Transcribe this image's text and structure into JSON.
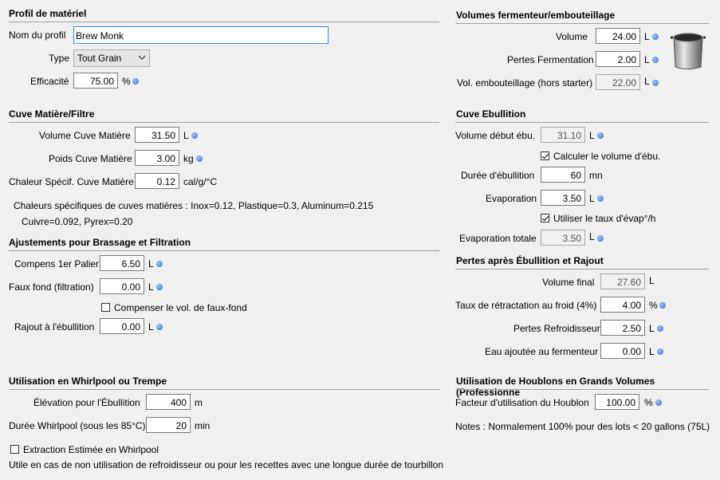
{
  "profil": {
    "title": "Profil de matériel",
    "nom_label": "Nom du profil",
    "nom_value": "Brew Monk",
    "type_label": "Type",
    "type_value": "Tout Grain",
    "efficacite_label": "Efficacité",
    "efficacite_value": "75.00",
    "efficacite_unit": "%"
  },
  "cuve_matiere": {
    "title": "Cuve Matière/Filtre",
    "volume_label": "Volume Cuve Matière",
    "volume_value": "31.50",
    "volume_unit": "L",
    "poids_label": "Poids Cuve Matière",
    "poids_value": "3.00",
    "poids_unit": "kg",
    "chaleur_label": "Chaleur Spécif. Cuve Matière",
    "chaleur_value": "0.12",
    "chaleur_unit": "cal/g/°C",
    "note_line1": "Chaleurs spécifiques de cuves matières : Inox=0.12, Plastique=0.3, Aluminum=0.215",
    "note_line2": "Cuivre=0.092, Pyrex=0.20"
  },
  "ajustements": {
    "title": "Ajustements pour Brassage et Filtration",
    "compens_label": "Compens 1er Palier",
    "compens_value": "6.50",
    "compens_unit": "L",
    "faux_fond_label": "Faux fond (filtration)",
    "faux_fond_value": "0.00",
    "faux_fond_unit": "L",
    "compenser_label": "Compenser le vol. de faux-fond",
    "rajout_label": "Rajout à l'ébullition",
    "rajout_value": "0.00",
    "rajout_unit": "L"
  },
  "whirlpool": {
    "title": "Utilisation en Whirlpool ou Trempe",
    "elevation_label": "Élévation pour l'Ébullition",
    "elevation_value": "400",
    "elevation_unit": "m",
    "duree_label": "Durée Whirlpool (sous les 85°C)",
    "duree_value": "20",
    "duree_unit": "min",
    "extraction_label": "Extraction Estimée en Whirlpool",
    "note": "Utile en cas de non utilisation de refroidisseur ou pour les recettes avec une longue durée de tourbillon"
  },
  "volumes": {
    "title": "Volumes fermenteur/embouteillage",
    "volume_label": "Volume",
    "volume_value": "24.00",
    "volume_unit": "L",
    "pertes_label": "Pertes Fermentation",
    "pertes_value": "2.00",
    "pertes_unit": "L",
    "embout_label": "Vol. embouteillage (hors starter)",
    "embout_value": "22.00",
    "embout_unit": "L"
  },
  "cuve_ebullition": {
    "title": "Cuve Ebullition",
    "debut_label": "Volume début ébu.",
    "debut_value": "31.10",
    "debut_unit": "L",
    "calculer_label": "Calculer le volume d'ébu.",
    "duree_label": "Durée d'ébullition",
    "duree_value": "60",
    "duree_unit": "mn",
    "evap_label": "Evaporation",
    "evap_value": "3.50",
    "evap_unit": "L",
    "taux_label": "Utiliser le taux d'évap°/h",
    "evap_totale_label": "Evaporation totale",
    "evap_totale_value": "3.50",
    "evap_totale_unit": "L"
  },
  "pertes": {
    "title": "Pertes après Ébullition et Rajout",
    "volume_final_label": "Volume final",
    "volume_final_value": "27.60",
    "volume_final_unit": "L",
    "taux_label": "Taux de rétractation au froid (4%)",
    "taux_value": "4.00",
    "taux_unit": "%",
    "refroid_label": "Pertes Refroidisseur",
    "refroid_value": "2.50",
    "refroid_unit": "L",
    "eau_label": "Eau ajoutée au fermenteur",
    "eau_value": "0.00",
    "eau_unit": "L"
  },
  "houblons": {
    "title": "Utilisation de Houblons en Grands Volumes (Professionne",
    "facteur_label": "Facteur d'utilisation du Houblon",
    "facteur_value": "100.00",
    "facteur_unit": "%",
    "notes": "Notes : Normalement  100% pour des lots < 20 gallons (75L)"
  },
  "icons": {
    "info_dot": "info-dot-icon",
    "pot": "brew-pot-icon",
    "dropdown": "chevron-down-icon",
    "accent": "#3a7bd5"
  }
}
